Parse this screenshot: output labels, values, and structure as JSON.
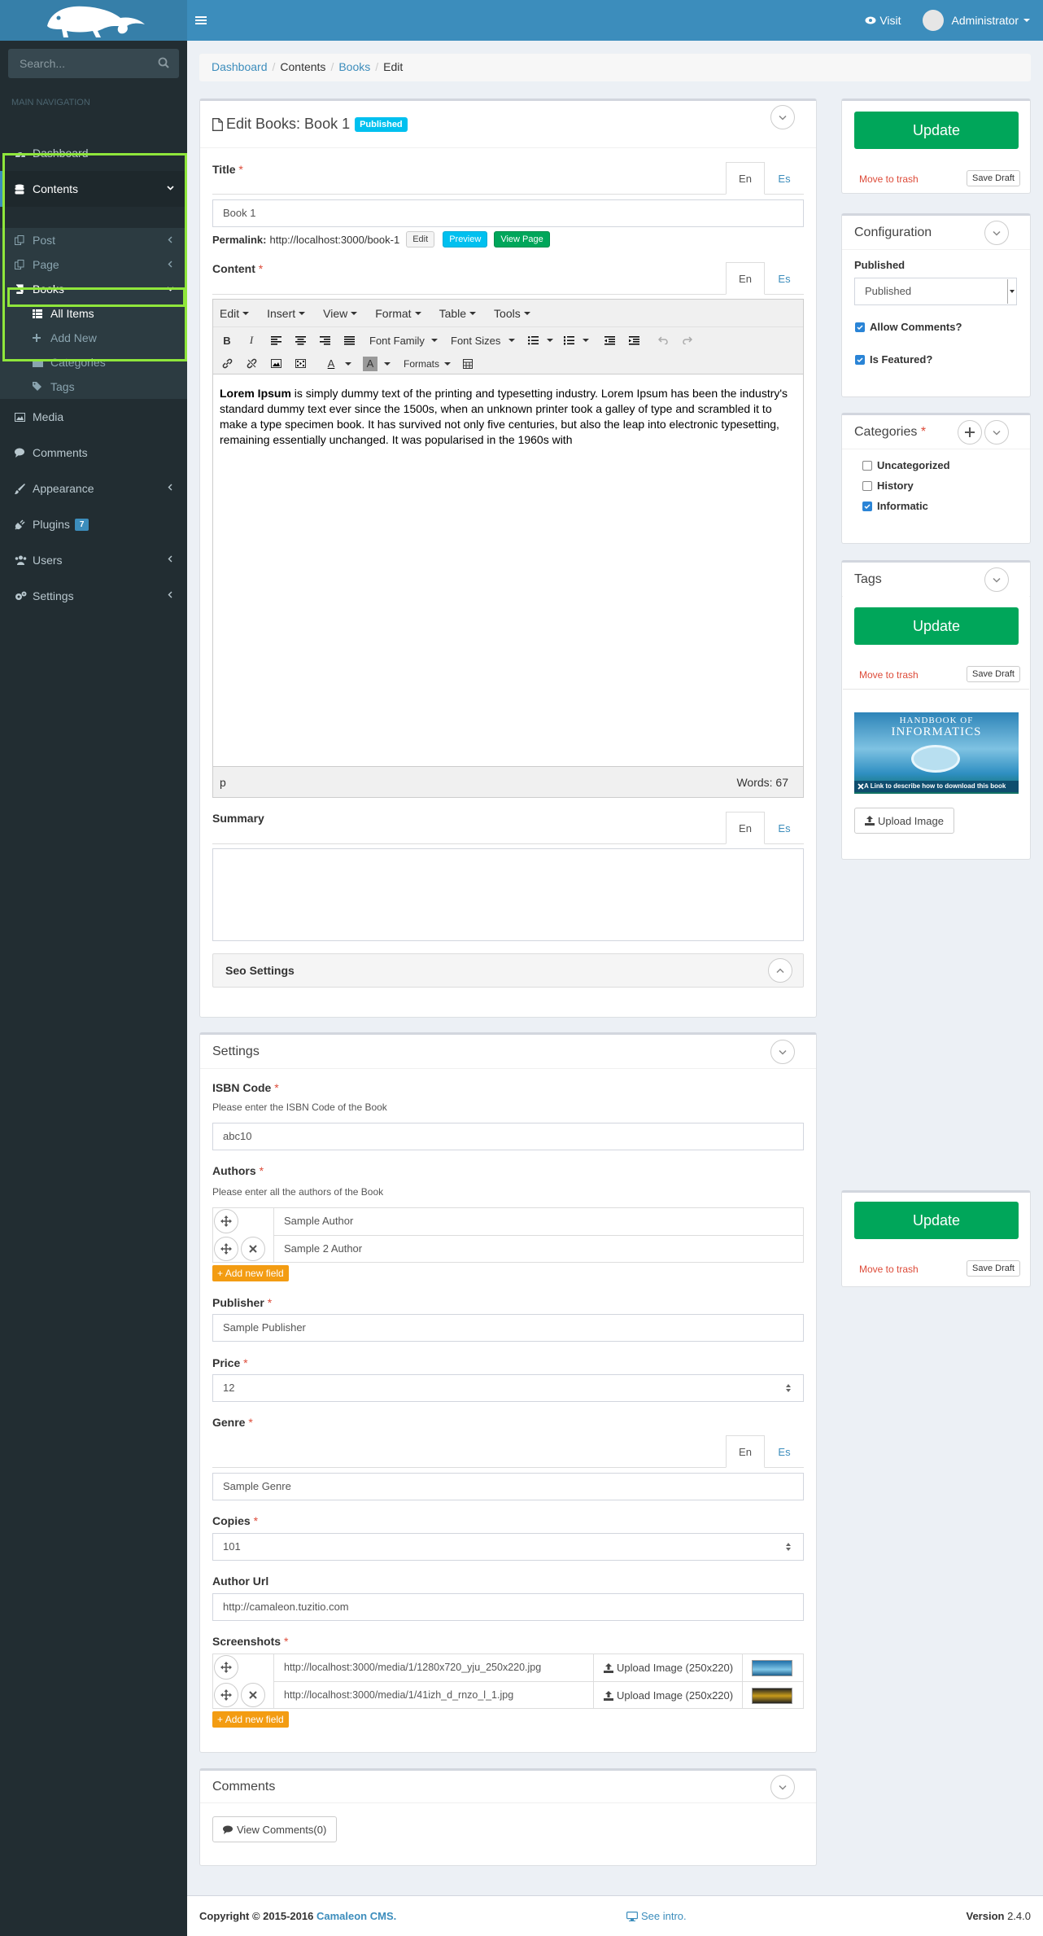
{
  "header": {
    "visit_label": "Visit",
    "user_label": "Administrator"
  },
  "sidebar": {
    "search_placeholder": "Search...",
    "nav_header": "MAIN NAVIGATION",
    "dashboard": "Dashboard",
    "contents": "Contents",
    "post": "Post",
    "page": "Page",
    "books": "Books",
    "all_items": "All Items",
    "add_new": "Add New",
    "categories": "Categories",
    "tags": "Tags",
    "media": "Media",
    "comments": "Comments",
    "appearance": "Appearance",
    "plugins": "Plugins",
    "plugins_badge": "7",
    "users": "Users",
    "settings": "Settings"
  },
  "breadcrumb": {
    "dashboard": "Dashboard",
    "contents": "Contents",
    "books": "Books",
    "edit": "Edit"
  },
  "edit_box": {
    "title": "Edit Books: Book 1",
    "status_badge": "Published",
    "title_label": "Title",
    "tab_en": "En",
    "tab_es": "Es",
    "title_value": "Book 1",
    "permalink_label": "Permalink:",
    "permalink_url": "http://localhost:3000/book-1",
    "edit_btn": "Edit",
    "preview_btn": "Preview",
    "view_page_btn": "View Page",
    "content_label": "Content",
    "summary_label": "Summary",
    "seo_label": "Seo Settings"
  },
  "editor": {
    "menus": [
      "Edit",
      "Insert",
      "View",
      "Format",
      "Table",
      "Tools"
    ],
    "font_family": "Font Family",
    "font_sizes": "Font Sizes",
    "formats": "Formats",
    "content_bold": "Lorem Ipsum",
    "content_rest": " is simply dummy text of the printing and typesetting industry. Lorem Ipsum has been the industry's standard dummy text ever since the 1500s, when an unknown printer took a galley of type and scrambled it to make a type specimen book. It has survived not only five centuries, but also the leap into electronic typesetting, remaining essentially unchanged. It was popularised in the 1960s with",
    "status_path": "p",
    "word_count": "Words: 67"
  },
  "settings_box": {
    "title": "Settings",
    "isbn_label": "ISBN Code",
    "isbn_help": "Please enter the ISBN Code of the Book",
    "isbn_value": "abc10",
    "authors_label": "Authors",
    "authors_help": "Please enter all the authors of the Book",
    "authors": [
      "Sample Author",
      "Sample 2 Author"
    ],
    "add_new_field": "Add new field",
    "publisher_label": "Publisher",
    "publisher_value": "Sample Publisher",
    "price_label": "Price",
    "price_value": "12",
    "genre_label": "Genre",
    "genre_value": "Sample Genre",
    "copies_label": "Copies",
    "copies_value": "101",
    "author_url_label": "Author Url",
    "author_url_value": "http://camaleon.tuzitio.com",
    "screenshots_label": "Screenshots",
    "screenshots": [
      "http://localhost:3000/media/1/1280x720_yju_250x220.jpg",
      "http://localhost:3000/media/1/41izh_d_rnzo_l_1.jpg"
    ],
    "upload_250": "Upload Image (250x220)"
  },
  "comments_box": {
    "title": "Comments",
    "view_btn": "View Comments(0)"
  },
  "publish": {
    "update": "Update",
    "move_to_trash": "Move to trash",
    "save_draft": "Save Draft"
  },
  "configuration": {
    "title": "Configuration",
    "published_label": "Published",
    "published_value": "Published",
    "allow_comments": "Allow Comments?",
    "is_featured": "Is Featured?"
  },
  "categories_box": {
    "title": "Categories",
    "items": [
      "Uncategorized",
      "History",
      "Informatic"
    ]
  },
  "tags_box": {
    "title": "Tags"
  },
  "featured": {
    "img_line1": "HANDBOOK OF",
    "img_line2": "INFORMATICS",
    "img_caption": "A Link to describe how to download this book",
    "upload_btn": "Upload Image"
  },
  "footer": {
    "copyright": "Copyright © 2015-2016",
    "brand": "Camaleon CMS.",
    "intro": "See intro.",
    "version_label": "Version",
    "version_value": "2.4.0"
  },
  "colors": {
    "primary": "#3c8dbc",
    "success": "#00a65a",
    "warning": "#f39c12",
    "danger": "#dd4b39",
    "sidebar": "#222d32",
    "highlight": "#8fe63b"
  }
}
